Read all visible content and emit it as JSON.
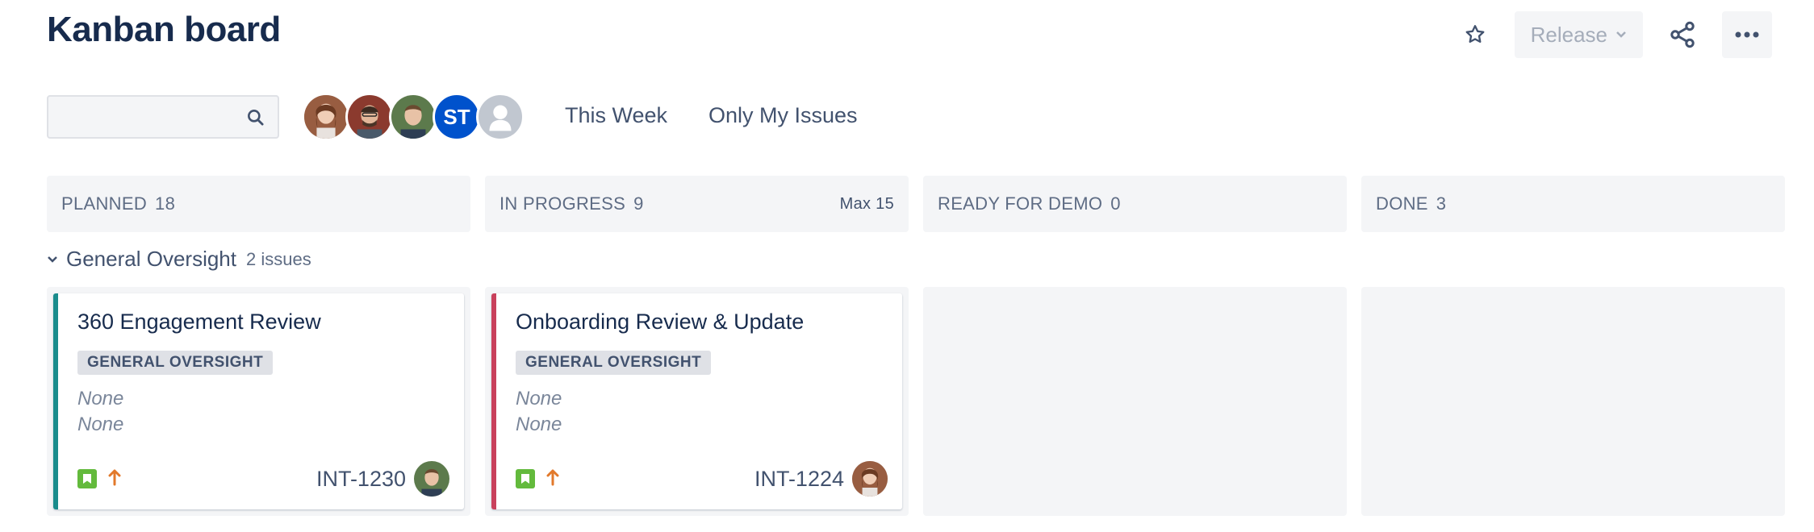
{
  "page": {
    "title": "Kanban board"
  },
  "top_actions": {
    "star_icon": "star-icon",
    "release_label": "Release",
    "share_icon": "share-icon",
    "more_icon": "more-icon"
  },
  "filters": {
    "search_placeholder": "",
    "avatars": [
      {
        "kind": "photo"
      },
      {
        "kind": "photo"
      },
      {
        "kind": "photo"
      },
      {
        "kind": "initials",
        "initials": "ST"
      },
      {
        "kind": "empty"
      }
    ],
    "quick_filters": [
      "This Week",
      "Only My Issues"
    ]
  },
  "columns": [
    {
      "name": "PLANNED",
      "count": "18",
      "max": ""
    },
    {
      "name": "IN PROGRESS",
      "count": "9",
      "max": "Max 15"
    },
    {
      "name": "READY FOR DEMO",
      "count": "0",
      "max": ""
    },
    {
      "name": "DONE",
      "count": "3",
      "max": ""
    }
  ],
  "swimlane": {
    "title": "General Oversight",
    "count": "2 issues"
  },
  "cards": [
    {
      "title": "360 Engagement Review",
      "epic": "GENERAL OVERSIGHT",
      "field1": "None",
      "field2": "None",
      "key": "INT-1230",
      "accent": "#1A8C8C"
    },
    {
      "title": "Onboarding Review & Update",
      "epic": "GENERAL OVERSIGHT",
      "field1": "None",
      "field2": "None",
      "key": "INT-1224",
      "accent": "#C9415C"
    }
  ],
  "colors": {
    "story": "#63BA3C",
    "priority": "#E2792B",
    "brand": "#0052CC"
  }
}
